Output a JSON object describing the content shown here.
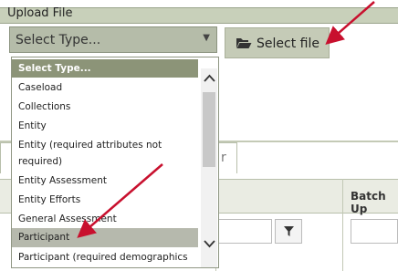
{
  "header": {
    "title": "Upload File"
  },
  "select_type": {
    "value": "Select Type...",
    "caret": "▼"
  },
  "select_file_button": {
    "label": "Select file",
    "icon": "folder-open-icon"
  },
  "tab": {
    "partial_label": "r"
  },
  "table": {
    "batch_column_label": "Batch Up"
  },
  "dropdown": {
    "options": [
      {
        "label": "Select Type...",
        "style": "header"
      },
      {
        "label": "Caseload"
      },
      {
        "label": "Collections"
      },
      {
        "label": "Entity"
      },
      {
        "label": "Entity (required attributes not required)"
      },
      {
        "label": "Entity Assessment"
      },
      {
        "label": "Entity Efforts"
      },
      {
        "label": "General Assessment"
      },
      {
        "label": "Participant",
        "style": "highlight"
      },
      {
        "label": "Participant (required demographics"
      }
    ],
    "scroll_up_icon": "chevron-up-icon",
    "scroll_down_icon": "chevron-down-icon"
  },
  "colors": {
    "accent": "#8c9478",
    "arrow": "#c8102e",
    "highlight": "#b6b9ad"
  }
}
